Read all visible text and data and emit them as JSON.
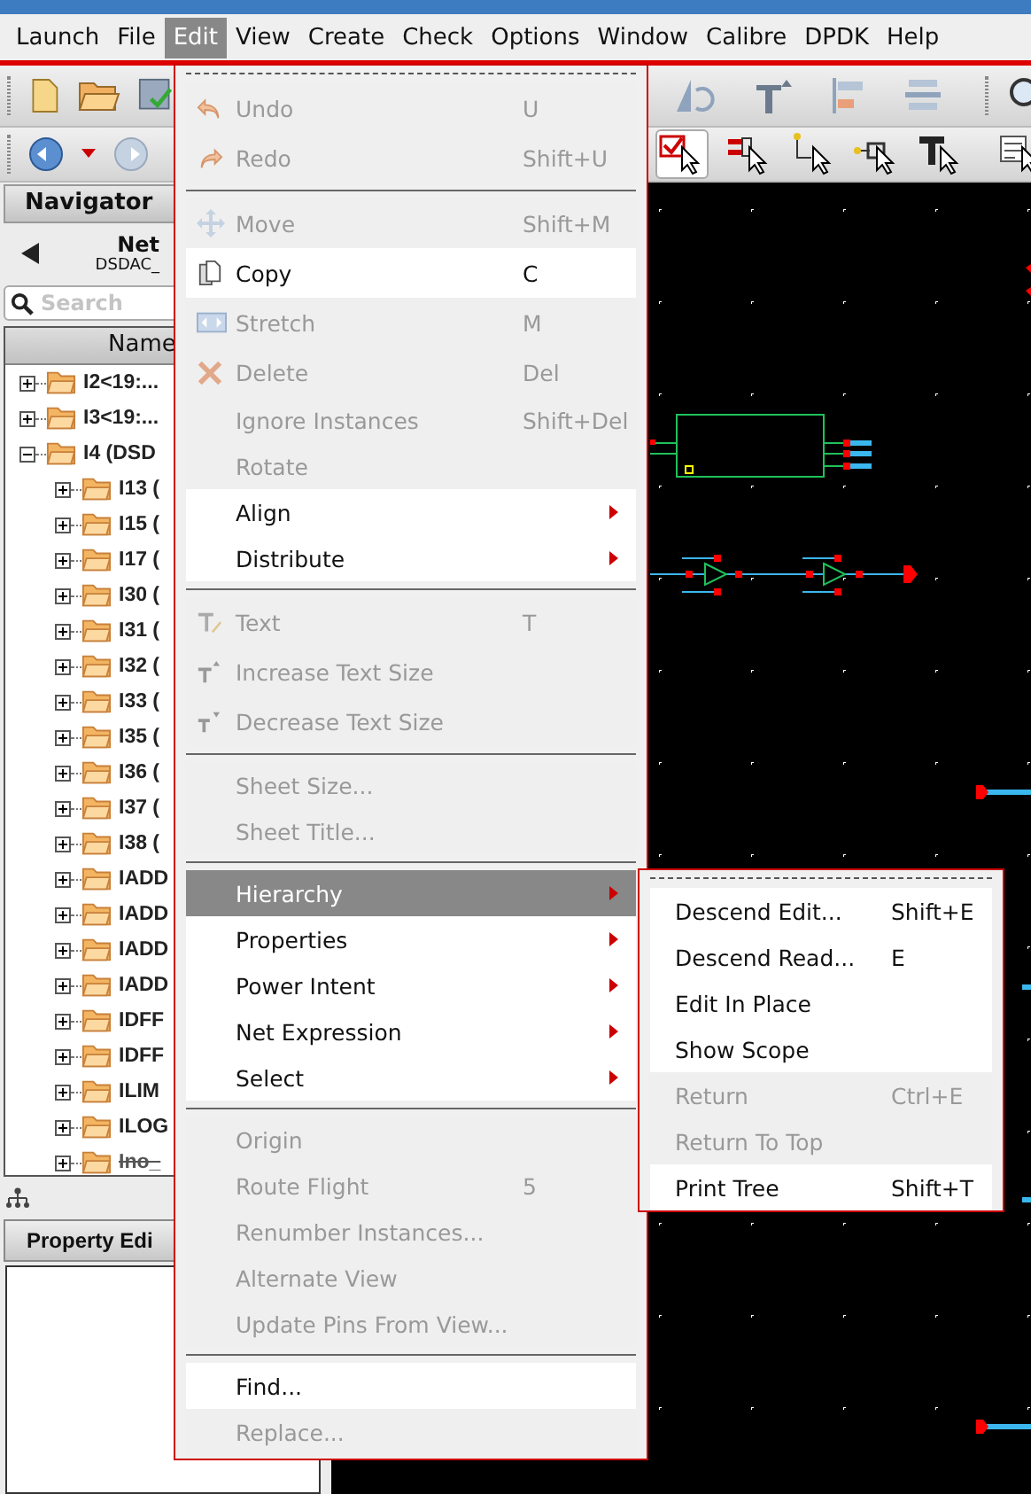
{
  "menubar": [
    {
      "label": "Launch",
      "selected": false
    },
    {
      "label": "File",
      "selected": false
    },
    {
      "label": "Edit",
      "selected": true
    },
    {
      "label": "View",
      "selected": false
    },
    {
      "label": "Create",
      "selected": false
    },
    {
      "label": "Check",
      "selected": false
    },
    {
      "label": "Options",
      "selected": false
    },
    {
      "label": "Window",
      "selected": false
    },
    {
      "label": "Calibre",
      "selected": false
    },
    {
      "label": "DPDK",
      "selected": false
    },
    {
      "label": "Help",
      "selected": false
    }
  ],
  "navigator": {
    "title": "Navigator",
    "net_label": "Net",
    "net_cell": "DSDAC_",
    "search_placeholder": "Search",
    "column": "Name",
    "tree": [
      {
        "label": "I2<19:...",
        "expanded": false,
        "struck": false
      },
      {
        "label": "I3<19:...",
        "expanded": false,
        "struck": false
      },
      {
        "label": "I4 (DSD",
        "expanded": true,
        "struck": false,
        "children": [
          {
            "label": "I13 (",
            "expanded": false,
            "struck": false
          },
          {
            "label": "I15 (",
            "expanded": false,
            "struck": false
          },
          {
            "label": "I17 (",
            "expanded": false,
            "struck": false
          },
          {
            "label": "I30 (",
            "expanded": false,
            "struck": false
          },
          {
            "label": "I31 (",
            "expanded": false,
            "struck": false
          },
          {
            "label": "I32 (",
            "expanded": false,
            "struck": false
          },
          {
            "label": "I33 (",
            "expanded": false,
            "struck": false
          },
          {
            "label": "I35 (",
            "expanded": false,
            "struck": false
          },
          {
            "label": "I36 (",
            "expanded": false,
            "struck": false
          },
          {
            "label": "I37 (",
            "expanded": false,
            "struck": false
          },
          {
            "label": "I38 (",
            "expanded": false,
            "struck": false
          },
          {
            "label": "IADD",
            "expanded": false,
            "struck": false
          },
          {
            "label": "IADD",
            "expanded": false,
            "struck": false
          },
          {
            "label": "IADD",
            "expanded": false,
            "struck": false
          },
          {
            "label": "IADD",
            "expanded": false,
            "struck": false
          },
          {
            "label": "IDFF",
            "expanded": false,
            "struck": false
          },
          {
            "label": "IDFF",
            "expanded": false,
            "struck": false
          },
          {
            "label": "ILIM",
            "expanded": false,
            "struck": false
          },
          {
            "label": "ILOG",
            "expanded": false,
            "struck": false
          },
          {
            "label": "Ino_",
            "expanded": false,
            "struck": true
          }
        ]
      }
    ]
  },
  "property_editor": {
    "tab": "Property Edi"
  },
  "edit_menu": {
    "items": [
      {
        "kind": "tearoff"
      },
      {
        "kind": "undo",
        "label": "Undo",
        "shortcut": "U",
        "disabled": true,
        "submenu": false,
        "selected": false
      },
      {
        "kind": "redo",
        "label": "Redo",
        "shortcut": "Shift+U",
        "disabled": true,
        "submenu": false,
        "selected": false
      },
      {
        "kind": "separator"
      },
      {
        "kind": "move",
        "label": "Move",
        "shortcut": "Shift+M",
        "disabled": true,
        "submenu": false,
        "selected": false
      },
      {
        "kind": "copy",
        "label": "Copy",
        "shortcut": "C",
        "disabled": false,
        "submenu": false,
        "selected": false
      },
      {
        "kind": "stretch",
        "label": "Stretch",
        "shortcut": "M",
        "disabled": true,
        "submenu": false,
        "selected": false
      },
      {
        "kind": "delete",
        "label": "Delete",
        "shortcut": "Del",
        "disabled": true,
        "submenu": false,
        "selected": false
      },
      {
        "kind": "item",
        "label": "Ignore Instances",
        "shortcut": "Shift+Del",
        "disabled": true,
        "submenu": false,
        "selected": false
      },
      {
        "kind": "item",
        "label": "Rotate",
        "disabled": true,
        "submenu": false,
        "selected": false
      },
      {
        "kind": "item",
        "label": "Align",
        "disabled": false,
        "submenu": true,
        "selected": false
      },
      {
        "kind": "item",
        "label": "Distribute",
        "disabled": false,
        "submenu": true,
        "selected": false
      },
      {
        "kind": "separator"
      },
      {
        "kind": "text",
        "label": "Text",
        "shortcut": "T",
        "disabled": true,
        "submenu": false,
        "selected": false
      },
      {
        "kind": "increase",
        "label": "Increase Text Size",
        "disabled": true,
        "submenu": false,
        "selected": false
      },
      {
        "kind": "decrease",
        "label": "Decrease Text Size",
        "disabled": true,
        "submenu": false,
        "selected": false
      },
      {
        "kind": "separator"
      },
      {
        "kind": "item",
        "label": "Sheet Size...",
        "disabled": true,
        "submenu": false,
        "selected": false
      },
      {
        "kind": "item",
        "label": "Sheet Title...",
        "disabled": true,
        "submenu": false,
        "selected": false
      },
      {
        "kind": "separator"
      },
      {
        "kind": "item",
        "label": "Hierarchy",
        "disabled": false,
        "submenu": true,
        "selected": true
      },
      {
        "kind": "item",
        "label": "Properties",
        "disabled": false,
        "submenu": true,
        "selected": false
      },
      {
        "kind": "item",
        "label": "Power Intent",
        "disabled": false,
        "submenu": true,
        "selected": false
      },
      {
        "kind": "item",
        "label": "Net Expression",
        "disabled": false,
        "submenu": true,
        "selected": false
      },
      {
        "kind": "item",
        "label": "Select",
        "disabled": false,
        "submenu": true,
        "selected": false
      },
      {
        "kind": "separator"
      },
      {
        "kind": "item",
        "label": "Origin",
        "disabled": true,
        "submenu": false,
        "selected": false
      },
      {
        "kind": "item",
        "label": "Route Flight",
        "shortcut": "5",
        "disabled": true,
        "submenu": false,
        "selected": false
      },
      {
        "kind": "item",
        "label": "Renumber Instances...",
        "disabled": true,
        "submenu": false,
        "selected": false
      },
      {
        "kind": "item",
        "label": "Alternate View",
        "disabled": true,
        "submenu": false,
        "selected": false
      },
      {
        "kind": "item",
        "label": "Update Pins From View...",
        "disabled": true,
        "submenu": false,
        "selected": false
      },
      {
        "kind": "separator"
      },
      {
        "kind": "item",
        "label": "Find...",
        "disabled": false,
        "submenu": false,
        "selected": false
      },
      {
        "kind": "item",
        "label": "Replace...",
        "disabled": true,
        "submenu": false,
        "selected": false
      }
    ]
  },
  "hierarchy_submenu": {
    "items": [
      {
        "kind": "tearoff"
      },
      {
        "kind": "item",
        "label": "Descend Edit...",
        "shortcut": "Shift+E",
        "disabled": false
      },
      {
        "kind": "item",
        "label": "Descend Read...",
        "shortcut": "E",
        "disabled": false
      },
      {
        "kind": "item",
        "label": "Edit In Place",
        "disabled": false
      },
      {
        "kind": "item",
        "label": "Show Scope",
        "disabled": false
      },
      {
        "kind": "item",
        "label": "Return",
        "shortcut": "Ctrl+E",
        "disabled": true
      },
      {
        "kind": "item",
        "label": "Return To Top",
        "disabled": true
      },
      {
        "kind": "item",
        "label": "Print Tree",
        "shortcut": "Shift+T",
        "disabled": false
      }
    ]
  }
}
